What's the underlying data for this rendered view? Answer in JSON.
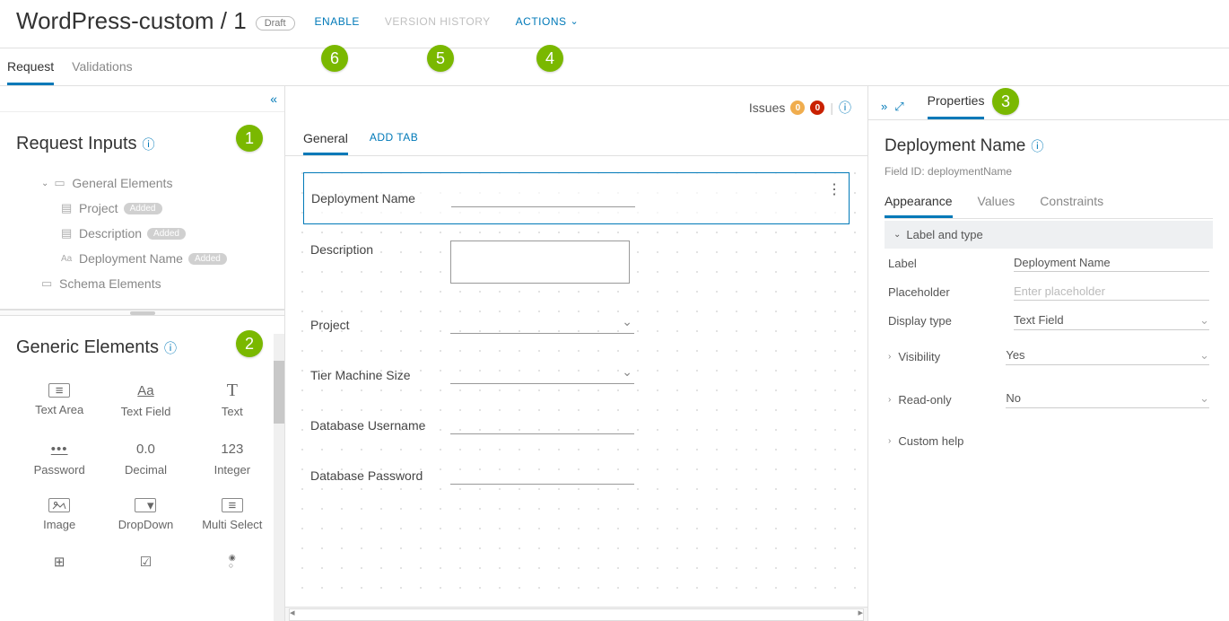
{
  "header": {
    "title": "WordPress-custom / 1",
    "status": "Draft",
    "enable": "ENABLE",
    "history": "VERSION HISTORY",
    "actions": "ACTIONS"
  },
  "subtabs": {
    "request": "Request",
    "validations": "Validations"
  },
  "annotations": {
    "1": "1",
    "2": "2",
    "3": "3",
    "4": "4",
    "5": "5",
    "6": "6"
  },
  "left": {
    "request_inputs": "Request Inputs",
    "tree": {
      "general": "General Elements",
      "project": "Project",
      "description": "Description",
      "deployment": "Deployment Name",
      "added": "Added",
      "schema": "Schema Elements"
    },
    "generic": "Generic Elements",
    "palette": [
      {
        "label": "Text Area"
      },
      {
        "label": "Text Field"
      },
      {
        "label": "Text"
      },
      {
        "label": "Password"
      },
      {
        "label": "Decimal"
      },
      {
        "label": "Integer"
      },
      {
        "label": "Image"
      },
      {
        "label": "DropDown"
      },
      {
        "label": "Multi Select"
      }
    ]
  },
  "canvas": {
    "issues": "Issues",
    "warn": "0",
    "err": "0",
    "tabs": {
      "general": "General",
      "add": "ADD TAB"
    },
    "fields": {
      "deployment": "Deployment Name",
      "description": "Description",
      "project": "Project",
      "tier": "Tier Machine Size",
      "dbuser": "Database Username",
      "dbpass": "Database Password"
    }
  },
  "right": {
    "tab": "Properties",
    "title": "Deployment Name",
    "fieldid_label": "Field ID:",
    "fieldid": "deploymentName",
    "ptabs": {
      "appearance": "Appearance",
      "values": "Values",
      "constraints": "Constraints"
    },
    "sections": {
      "label_type": "Label and type",
      "label": "Label",
      "label_val": "Deployment Name",
      "placeholder": "Placeholder",
      "placeholder_ph": "Enter placeholder",
      "display": "Display type",
      "display_val": "Text Field",
      "visibility": "Visibility",
      "visibility_val": "Yes",
      "readonly": "Read-only",
      "readonly_val": "No",
      "custom": "Custom help"
    }
  }
}
